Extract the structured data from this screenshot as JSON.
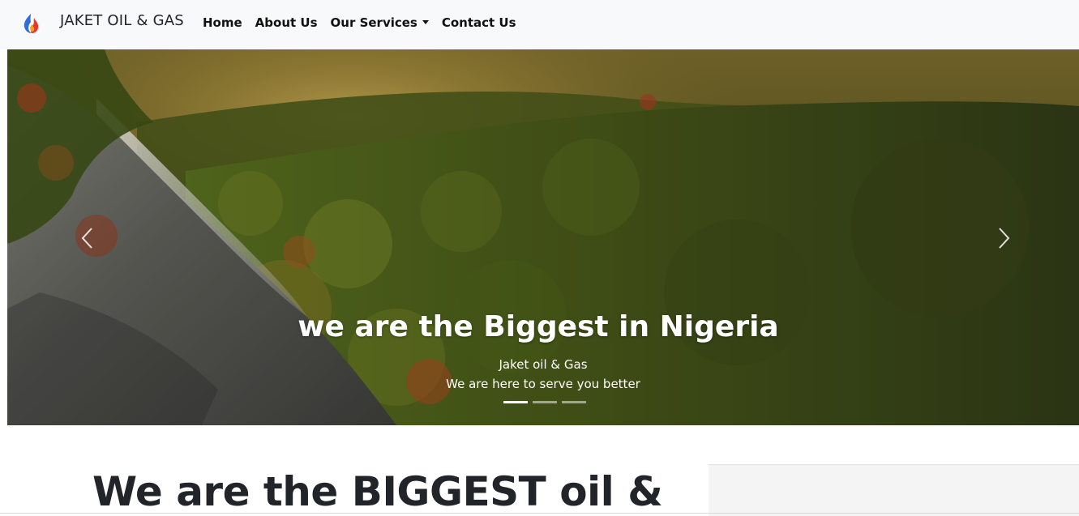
{
  "brand": {
    "name": "JAKET OIL & GAS",
    "logo_icon": "flame-icon"
  },
  "nav": {
    "items": [
      {
        "label": "Home"
      },
      {
        "label": "About Us"
      },
      {
        "label": "Our Services",
        "dropdown": true
      },
      {
        "label": "Contact Us"
      }
    ]
  },
  "carousel": {
    "title": "we are the Biggest in Nigeria",
    "subtitle": "Jaket oil & Gas",
    "tagline": "We are here to serve you better",
    "slide_count": 3,
    "active_slide": 1,
    "prev_icon": "chevron-left-icon",
    "next_icon": "chevron-right-icon"
  },
  "main": {
    "heading": "We are the BIGGEST oil &"
  },
  "colors": {
    "navbar_bg": "#f8f9fa",
    "nav_text": "#111111",
    "heading_text": "#212529",
    "caption_text": "#ffffff"
  }
}
